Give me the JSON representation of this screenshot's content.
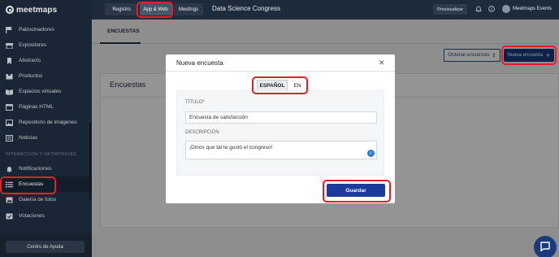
{
  "app": {
    "brand": "meetmaps",
    "event_title": "Data Science Congress",
    "org_name": "Meetmaps Events",
    "accent_color": "#1b3a7a",
    "highlight_color": "#e0202a"
  },
  "topbar": {
    "tabs": [
      {
        "label": "Registro"
      },
      {
        "label": "App & Web",
        "selected": true
      },
      {
        "label": "Meetings"
      }
    ],
    "preview_label": "Previsualizar",
    "icons": [
      "bell-icon",
      "info-icon",
      "avatar"
    ]
  },
  "sidebar": {
    "items": [
      {
        "label": "Patrocinadores",
        "icon": "flag-icon"
      },
      {
        "label": "Expositores",
        "icon": "store-icon"
      },
      {
        "label": "Abstracts",
        "icon": "bookmark-icon"
      },
      {
        "label": "Productos",
        "icon": "box-icon"
      },
      {
        "label": "Espacios virtuales",
        "icon": "book-icon"
      },
      {
        "label": "Páginas HTML",
        "icon": "html-icon"
      },
      {
        "label": "Repositorio de imágenes",
        "icon": "image-icon"
      },
      {
        "label": "Noticias",
        "icon": "news-icon"
      },
      {
        "label": "Notificaciones",
        "icon": "bell-icon"
      },
      {
        "label": "Encuestas",
        "icon": "list-icon",
        "active": true
      },
      {
        "label": "Galería de fotos",
        "icon": "gallery-icon"
      },
      {
        "label": "Votaciones",
        "icon": "vote-icon"
      }
    ],
    "section_label": "INTERACCIÓN Y NETWORKING",
    "help_label": "Centro de Ayuda"
  },
  "main": {
    "subtab_label": "ENCUESTAS",
    "order_label": "Ordenar encuestas",
    "new_label": "Nueva encuesta",
    "panel_title": "Encuestas"
  },
  "modal": {
    "title": "Nueva encuesta",
    "lang_es": "ESPAÑOL",
    "lang_en": "EN",
    "title_label": "TÍTULO*",
    "title_value": "Encuesta de satisfacción",
    "desc_label": "DESCRIPCIÓN",
    "desc_value": "¡Dinos que tal te gustó el congreso!",
    "save_label": "Guardar"
  }
}
